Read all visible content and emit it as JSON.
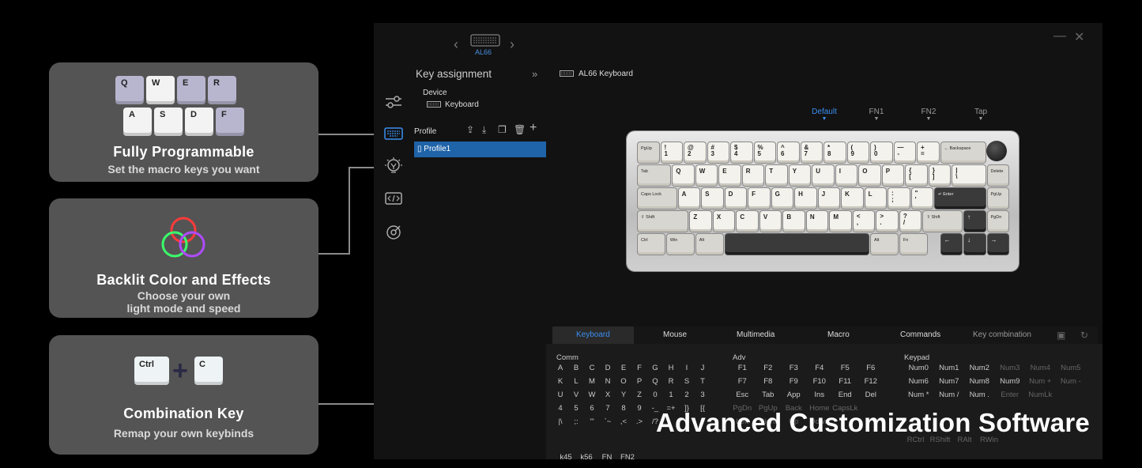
{
  "cards": [
    {
      "title": "Fully Programmable",
      "subtitle": "Set the macro keys you want",
      "keys_row1": [
        "Q",
        "W",
        "E",
        "R"
      ],
      "keys_row2": [
        "A",
        "S",
        "D",
        "F"
      ]
    },
    {
      "title": "Backlit Color and Effects",
      "subtitle_line1": "Choose your own",
      "subtitle_line2": "light mode and speed"
    },
    {
      "title": "Combination Key",
      "subtitle": "Remap your own keybinds",
      "key_left": "Ctrl",
      "key_right": "C"
    }
  ],
  "app": {
    "device_top_label": "AL66",
    "panel_title": "Key assignment",
    "collapse_icon": "»",
    "device_label": "Device",
    "device_value": "Keyboard",
    "profile_label": "Profile",
    "profile_selected": "Profile1",
    "keyboard_name": "AL66 Keyboard",
    "layers": [
      "Default",
      "FN1",
      "FN2",
      "Tap"
    ],
    "tabs": [
      "Keyboard",
      "Mouse",
      "Multimedia",
      "Macro",
      "Commands",
      "Key combination"
    ],
    "sections": {
      "comm": "Comm",
      "adv": "Adv",
      "keypad": "Keypad"
    },
    "comm_keys": [
      [
        "A",
        "B",
        "C",
        "D",
        "E",
        "F",
        "G",
        "H",
        "I",
        "J"
      ],
      [
        "K",
        "L",
        "M",
        "N",
        "O",
        "P",
        "Q",
        "R",
        "S",
        "T"
      ],
      [
        "U",
        "V",
        "W",
        "X",
        "Y",
        "Z",
        "0",
        "1",
        "2",
        "3"
      ],
      [
        "4",
        "5",
        "6",
        "7",
        "8",
        "9",
        "-_",
        "=+",
        "]}",
        "[{"
      ],
      [
        "|\\",
        ";:",
        "'\"",
        "`~",
        ",<",
        ".>",
        "/?"
      ],
      [
        "k45",
        "k56",
        "FN",
        "FN2"
      ]
    ],
    "adv_keys": [
      [
        "F1",
        "F2",
        "F3",
        "F4",
        "F5",
        "F6"
      ],
      [
        "F7",
        "F8",
        "F9",
        "F10",
        "F11",
        "F12"
      ],
      [
        "Esc",
        "Tab",
        "App",
        "Ins",
        "End",
        "Del"
      ],
      [
        "PgDn",
        "PgUp",
        "Back",
        "Home",
        "CapsLk"
      ],
      [
        "Left",
        "Right",
        "Up",
        "Down"
      ]
    ],
    "keypad_keys": [
      [
        "Num0",
        "Num1",
        "Num2",
        "Num3",
        "Num4",
        "Num5"
      ],
      [
        "Num6",
        "Num7",
        "Num8",
        "Num9",
        "Num +",
        "Num -"
      ],
      [
        "Num *",
        "Num /",
        "Num .",
        "Enter",
        "NumLk"
      ],
      [
        "RCtrl",
        "RShift",
        "RAlt",
        "RWin"
      ]
    ]
  },
  "keyboard_layout": {
    "row1": [
      "PgUp",
      "!\n1",
      "@\n2",
      "#\n3",
      "$\n4",
      "%\n5",
      "^\n6",
      "&\n7",
      "*\n8",
      "(\n9",
      ")\n0",
      "—\n-",
      "+\n=",
      "← Backspace"
    ],
    "row2": [
      "Tab",
      "Q",
      "W",
      "E",
      "R",
      "T",
      "Y",
      "U",
      "I",
      "O",
      "P",
      "{\n[",
      "}\n]",
      "|\n\\",
      "Delete"
    ],
    "row3": [
      "Caps Lock",
      "A",
      "S",
      "D",
      "F",
      "G",
      "H",
      "J",
      "K",
      "L",
      ":\n;",
      "\"\n'",
      "↵ Enter",
      "PgUp"
    ],
    "row4": [
      "⇧ Shift",
      "Z",
      "X",
      "C",
      "V",
      "B",
      "N",
      "M",
      "<\n,",
      ">\n.",
      "?\n/",
      "⇧ Shift",
      "↑",
      "PgDn"
    ],
    "row5": [
      "Ctrl",
      "Win",
      "Alt",
      "",
      "Alt",
      "Fn",
      "",
      "←",
      "↓",
      "→"
    ]
  },
  "tagline": "Advanced Customization Software",
  "colors": {
    "accent": "#3b8ff0",
    "card_bg": "#545454",
    "app_bg": "#121212",
    "selection": "#1f63a8"
  }
}
